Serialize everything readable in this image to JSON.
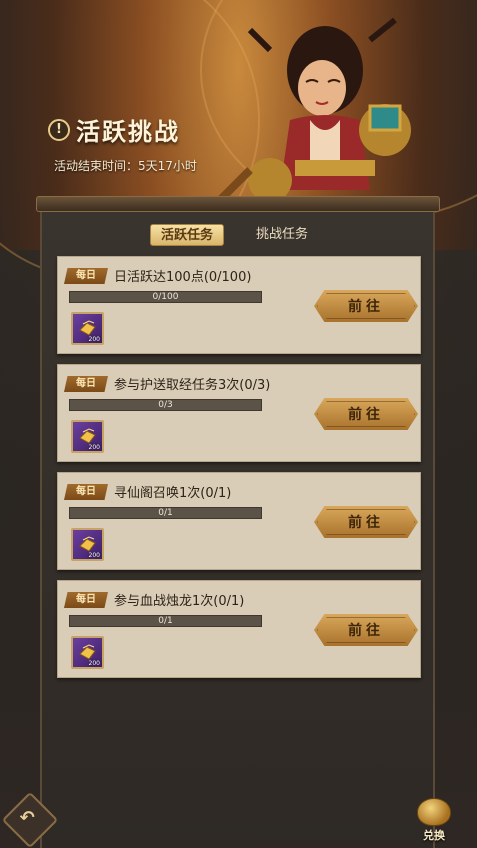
{
  "header": {
    "title": "活跃挑战",
    "end_time_label": "活动结束时间：",
    "end_time_value": "5天17小时"
  },
  "tabs": [
    {
      "label": "活跃任务",
      "active": true
    },
    {
      "label": "挑战任务",
      "active": false
    }
  ],
  "tasks": [
    {
      "tag": "每日",
      "name": "日活跃达100点(0/100)",
      "progress_text": "0/100",
      "progress": 0,
      "reward_qty": "200",
      "button": "前往"
    },
    {
      "tag": "每日",
      "name": "参与护送取经任务3次(0/3)",
      "progress_text": "0/3",
      "progress": 0,
      "reward_qty": "200",
      "button": "前往"
    },
    {
      "tag": "每日",
      "name": "寻仙阁召唤1次(0/1)",
      "progress_text": "0/1",
      "progress": 0,
      "reward_qty": "200",
      "button": "前往"
    },
    {
      "tag": "每日",
      "name": "参与血战烛龙1次(0/1)",
      "progress_text": "0/1",
      "progress": 0,
      "reward_qty": "200",
      "button": "前往"
    }
  ],
  "footer": {
    "exchange_label": "兑换"
  },
  "colors": {
    "button": "#c8924a",
    "card": "#d9cdb7",
    "tag": "#8c5a22",
    "reward_frame": "#5a2e86"
  }
}
